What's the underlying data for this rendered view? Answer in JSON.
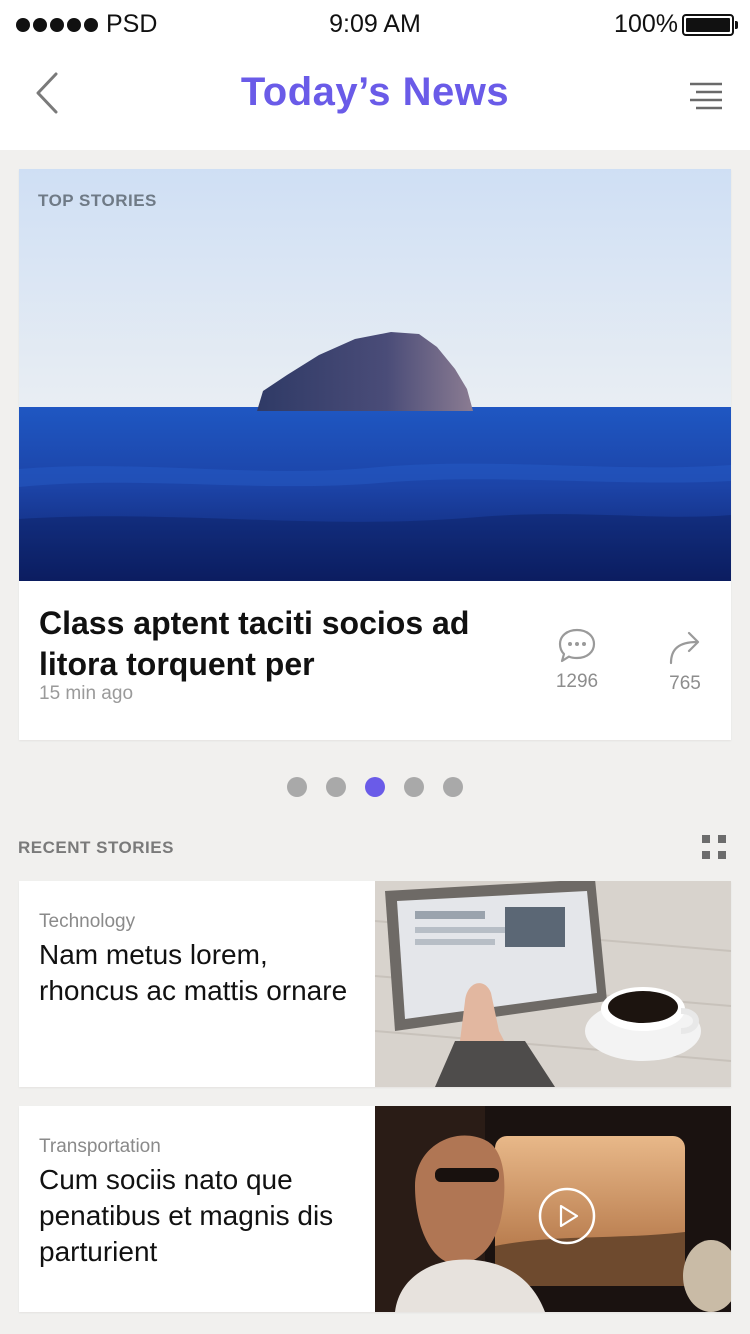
{
  "status_bar": {
    "carrier": "PSD",
    "time": "9:09 AM",
    "battery": "100%"
  },
  "nav": {
    "title": "Today’s News",
    "title_color": "#6a5be8"
  },
  "top_story": {
    "label": "TOP STORIES",
    "headline": "Class aptent taciti socios ad litora torquent per",
    "time_ago": "15 min ago",
    "comments": "1296",
    "shares": "765"
  },
  "pagination": {
    "count": 5,
    "active_index": 2
  },
  "recent": {
    "label": "RECENT STORIES",
    "stories": [
      {
        "category": "Technology",
        "title": "Nam metus lorem, rhoncus ac mattis ornare"
      },
      {
        "category": "Transportation",
        "title": "Cum sociis nato que penatibus et magnis dis parturient"
      }
    ]
  },
  "icons": {
    "back": "chevron-left-icon",
    "menu": "menu-lines-icon",
    "comment": "speech-bubble-icon",
    "share": "share-arrow-icon",
    "grid": "grid-view-icon",
    "play": "play-icon"
  }
}
